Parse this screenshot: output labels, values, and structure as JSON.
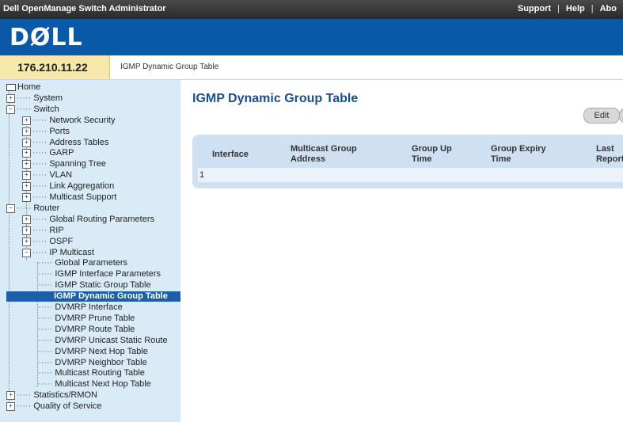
{
  "app": {
    "title": "Dell OpenManage Switch Administrator",
    "links": [
      "Support",
      "Help",
      "Abo"
    ]
  },
  "brand": {
    "logo_text": "DØLL",
    "brand_color": "#0a58a8"
  },
  "ipbar": {
    "ip": "176.210.11.22",
    "breadcrumb": "IGMP Dynamic Group Table"
  },
  "sidebar": {
    "items": [
      {
        "label": "Home",
        "glyph": "home-icon"
      },
      {
        "label": "System",
        "glyph": "plus-box"
      },
      {
        "label": "Switch",
        "glyph": "minus-box"
      },
      {
        "label": "Network Security",
        "glyph": "plus-box"
      },
      {
        "label": "Ports",
        "glyph": "plus-box"
      },
      {
        "label": "Address Tables",
        "glyph": "plus-box"
      },
      {
        "label": "GARP",
        "glyph": "plus-box"
      },
      {
        "label": "Spanning Tree",
        "glyph": "plus-box"
      },
      {
        "label": "VLAN",
        "glyph": "plus-box"
      },
      {
        "label": "Link Aggregation",
        "glyph": "plus-box"
      },
      {
        "label": "Multicast Support",
        "glyph": "plus-box"
      },
      {
        "label": "Router",
        "glyph": "minus-box"
      },
      {
        "label": "Global Routing Parameters",
        "glyph": "plus-box"
      },
      {
        "label": "RIP",
        "glyph": "plus-box"
      },
      {
        "label": "OSPF",
        "glyph": "plus-box"
      },
      {
        "label": "IP Multicast",
        "glyph": "minus-box"
      },
      {
        "label": "Global Parameters"
      },
      {
        "label": "IGMP Interface Parameters"
      },
      {
        "label": "IGMP Static Group Table"
      },
      {
        "label": "IGMP Dynamic Group Table",
        "selected": true
      },
      {
        "label": "DVMRP Interface"
      },
      {
        "label": "DVMRP Prune Table"
      },
      {
        "label": "DVMRP Route Table"
      },
      {
        "label": "DVMRP Unicast Static Route"
      },
      {
        "label": "DVMRP Next Hop Table"
      },
      {
        "label": "DVMRP Neighbor Table"
      },
      {
        "label": "Multicast Routing Table"
      },
      {
        "label": "Multicast Next Hop Table"
      },
      {
        "label": "Statistics/RMON",
        "glyph": "plus-box"
      },
      {
        "label": "Quality of Service",
        "glyph": "plus-box"
      }
    ]
  },
  "main": {
    "title": "IGMP Dynamic Group Table",
    "edit_button": "Edit",
    "table": {
      "headers": [
        "Interface",
        "Multicast Group Address",
        "Group Up Time",
        "Group Expiry Time",
        "Last Reporter"
      ],
      "rows": [
        [
          "1",
          "",
          "",
          "",
          ""
        ]
      ]
    }
  }
}
